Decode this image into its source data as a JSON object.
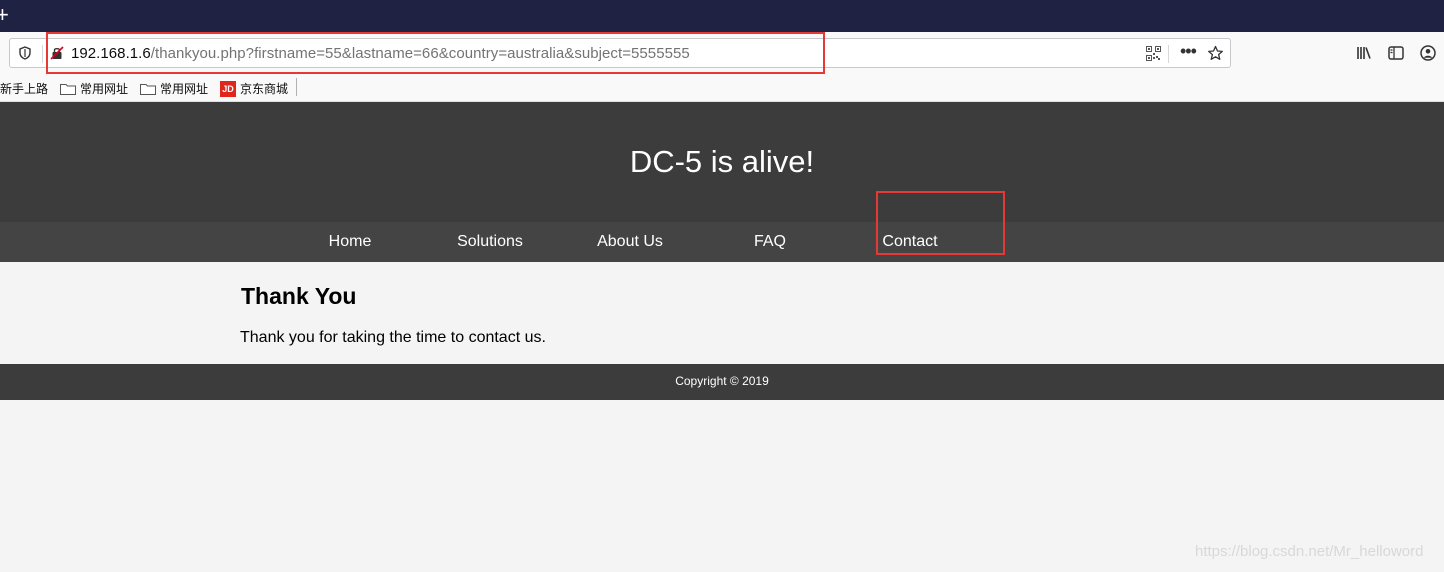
{
  "browser": {
    "url_host": "192.168.1.6",
    "url_path": "/thankyou.php?firstname=55&lastname=66&country=australia&subject=5555555",
    "bookmarks": [
      "新手上路",
      "常用网址",
      "常用网址",
      "京东商城"
    ],
    "jd_logo_text": "JD"
  },
  "site": {
    "title": "DC-5 is alive!",
    "nav": [
      "Home",
      "Solutions",
      "About Us",
      "FAQ",
      "Contact"
    ],
    "heading": "Thank You",
    "message": "Thank you for taking the time to contact us.",
    "footer": "Copyright © 2019"
  },
  "watermark": "https://blog.csdn.net/Mr_helloword",
  "colors": {
    "titlebar": "#1f2242",
    "header": "#3c3c3c",
    "nav": "#444444",
    "annotation": "#e53935"
  }
}
